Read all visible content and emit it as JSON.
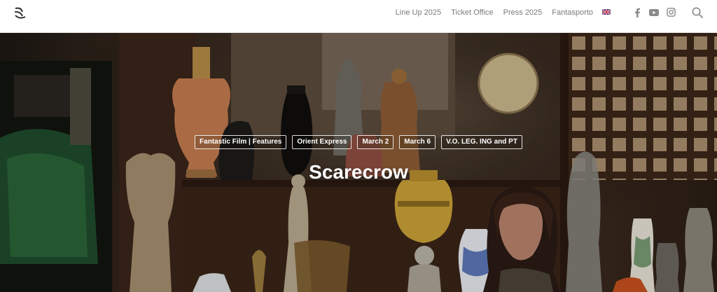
{
  "header": {
    "nav": [
      "Line Up 2025",
      "Ticket Office",
      "Press 2025",
      "Fantasporto"
    ],
    "language": "English",
    "social_icons": [
      "facebook-icon",
      "youtube-icon",
      "instagram-icon"
    ],
    "search_icon": "search-icon"
  },
  "hero": {
    "tags": [
      "Fantastic Film | Features",
      "Orient Express",
      "March 2",
      "March 6",
      "V.O. LEG. ING and PT"
    ],
    "title": "Scarecrow"
  },
  "colors": {
    "nav_text": "#7a7a7a",
    "icon_gray": "#8a8a8a",
    "hero_text": "#ffffff"
  }
}
